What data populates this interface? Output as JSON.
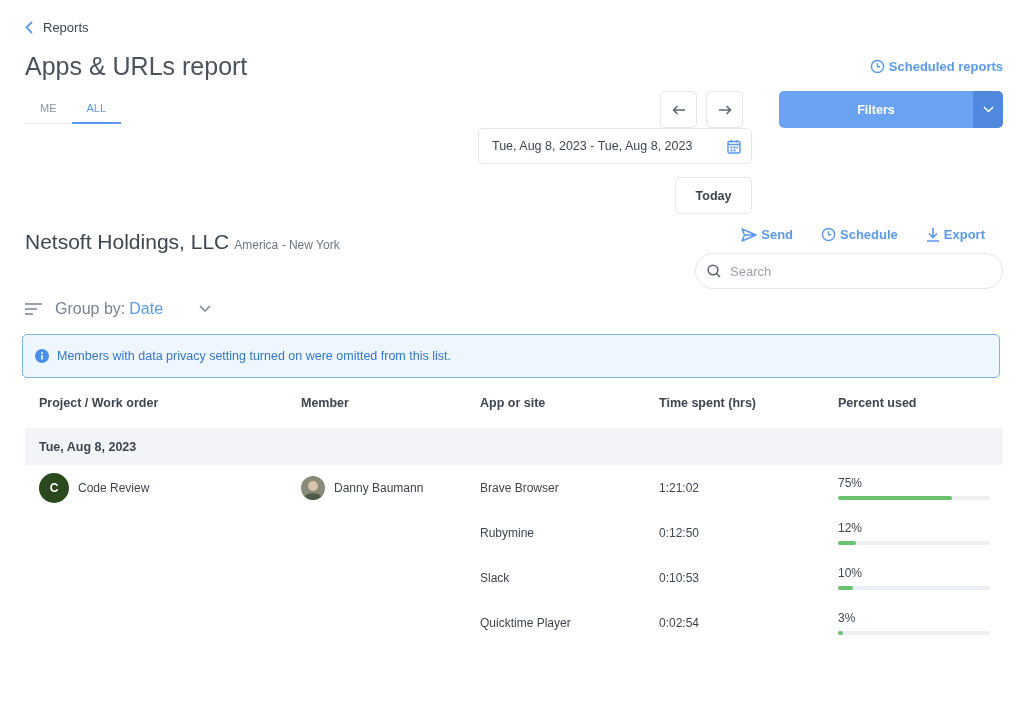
{
  "back_link": {
    "label": "Reports"
  },
  "title": "Apps & URLs report",
  "scheduled_reports_link": "Scheduled reports",
  "tabs": [
    {
      "label": "ME",
      "selected": false
    },
    {
      "label": "ALL",
      "selected": true
    }
  ],
  "date_range": {
    "value": "Tue, Aug 8, 2023 - Tue, Aug 8, 2023"
  },
  "today_button": "Today",
  "filters_button": "Filters",
  "organization": {
    "name": "Netsoft Holdings, LLC",
    "timezone": "America - New York"
  },
  "actions": [
    {
      "kind": "send",
      "label": "Send"
    },
    {
      "kind": "schedule",
      "label": "Schedule"
    },
    {
      "kind": "export",
      "label": "Export"
    }
  ],
  "search": {
    "placeholder": "Search"
  },
  "group_by": {
    "label": "Group by:",
    "value": "Date"
  },
  "notice": "Members with data privacy setting turned on were omitted from this list.",
  "table": {
    "columns": [
      "Project / Work order",
      "Member",
      "App or site",
      "Time spent (hrs)",
      "Percent used"
    ],
    "groups": [
      {
        "label": "Tue, Aug 8, 2023",
        "rows": [
          {
            "project_initial": "C",
            "project": "Code Review",
            "member": "Danny Baumann",
            "app": "Brave Browser",
            "time": "1:21:02",
            "percent": "75%",
            "level": 0.75
          },
          {
            "app": "Rubymine",
            "time": "0:12:50",
            "percent": "12%",
            "level": 0.12
          },
          {
            "app": "Slack",
            "time": "0:10:53",
            "percent": "10%",
            "level": 0.1
          },
          {
            "app": "Quicktime Player",
            "time": "0:02:54",
            "percent": "3%",
            "level": 0.03
          }
        ]
      }
    ]
  }
}
